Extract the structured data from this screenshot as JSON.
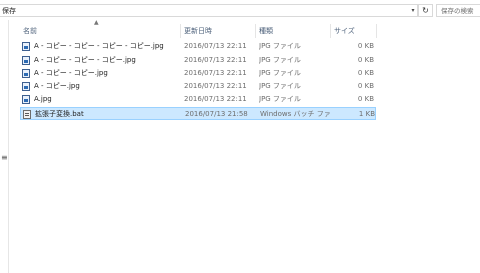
{
  "address": {
    "path": "保存"
  },
  "search": {
    "placeholder": "保存の検索"
  },
  "columns": {
    "name": "名前",
    "date": "更新日時",
    "type": "種類",
    "size": "サイズ"
  },
  "files": [
    {
      "name": "A - コピー - コピー - コピー - コピー.jpg",
      "date": "2016/07/13 22:11",
      "type": "JPG ファイル",
      "size": "0 KB",
      "icon": "jpg-file-icon"
    },
    {
      "name": "A - コピー - コピー - コピー.jpg",
      "date": "2016/07/13 22:11",
      "type": "JPG ファイル",
      "size": "0 KB",
      "icon": "jpg-file-icon"
    },
    {
      "name": "A - コピー - コピー.jpg",
      "date": "2016/07/13 22:11",
      "type": "JPG ファイル",
      "size": "0 KB",
      "icon": "jpg-file-icon"
    },
    {
      "name": "A - コピー.jpg",
      "date": "2016/07/13 22:11",
      "type": "JPG ファイル",
      "size": "0 KB",
      "icon": "jpg-file-icon"
    },
    {
      "name": "A.jpg",
      "date": "2016/07/13 22:11",
      "type": "JPG ファイル",
      "size": "0 KB",
      "icon": "jpg-file-icon"
    },
    {
      "name": "拡張子変換.bat",
      "date": "2016/07/13 21:58",
      "type": "Windows バッチ ファ...",
      "size": "1 KB",
      "icon": "batch-file-icon",
      "selected": true
    }
  ],
  "colors": {
    "selection_bg": "#cce8ff",
    "selection_border": "#99d1ff",
    "header_text": "#4c607a"
  }
}
